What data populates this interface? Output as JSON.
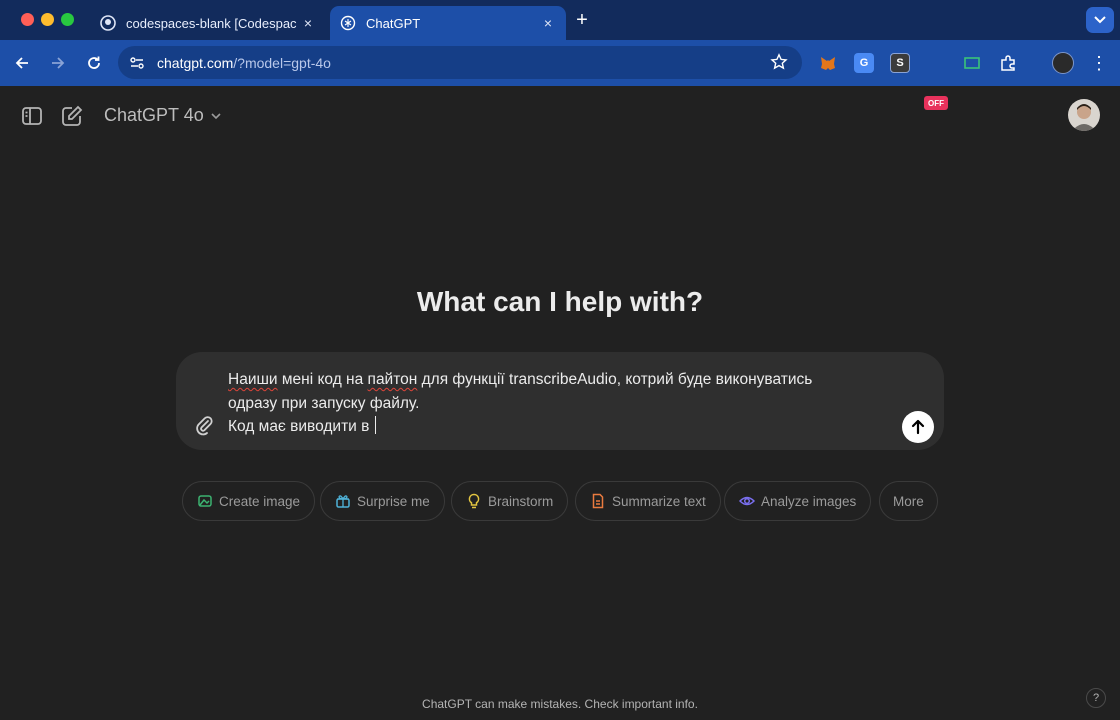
{
  "browser": {
    "tabs": [
      {
        "label": "codespaces-blank [Codespac",
        "icon": "github-icon"
      },
      {
        "label": "ChatGPT",
        "icon": "openai-icon",
        "active": true
      }
    ],
    "tab_close": "×",
    "new_tab": "+",
    "url_host": "chatgpt.com",
    "url_path": "/?model=gpt-4o",
    "extensions": [
      {
        "name": "metamask-icon",
        "text": "",
        "color": "#e2761b"
      },
      {
        "name": "google-translate-icon",
        "text": "G",
        "color": "#4a8af4"
      },
      {
        "name": "s-extension-icon",
        "text": "S",
        "color": "#3b3b3b"
      },
      {
        "name": "off-badge-icon",
        "text": "OFF",
        "color": "#e8325c"
      },
      {
        "name": "screen-capture-icon",
        "text": "",
        "color": "#3a9a5a"
      },
      {
        "name": "extensions-puzzle-icon",
        "text": "",
        "color": ""
      }
    ]
  },
  "app": {
    "model_label": "ChatGPT 4o",
    "hero": "What can I help with?",
    "composer": {
      "line1_word": "Наиши",
      "line1_rest": " мені код на ",
      "line1_word2": "пайтон",
      "line1_tail": " для функції transcribeAudio, котрий буде виконуватись",
      "line2": "одразу при запуску файлу.",
      "line3": "Код має виводити в "
    },
    "chips": [
      {
        "label": "Create image",
        "icon": "create-image-icon",
        "color": "#3cb371"
      },
      {
        "label": "Surprise me",
        "icon": "surprise-gift-icon",
        "color": "#4fb3d9"
      },
      {
        "label": "Brainstorm",
        "icon": "lightbulb-icon",
        "color": "#e2c541"
      },
      {
        "label": "Summarize text",
        "icon": "document-icon",
        "color": "#ea7b3f"
      },
      {
        "label": "Analyze images",
        "icon": "eye-icon",
        "color": "#7a6ff0"
      },
      {
        "label": "More",
        "icon": "",
        "color": ""
      }
    ],
    "disclaimer": "ChatGPT can make mistakes. Check important info.",
    "help": "?"
  }
}
